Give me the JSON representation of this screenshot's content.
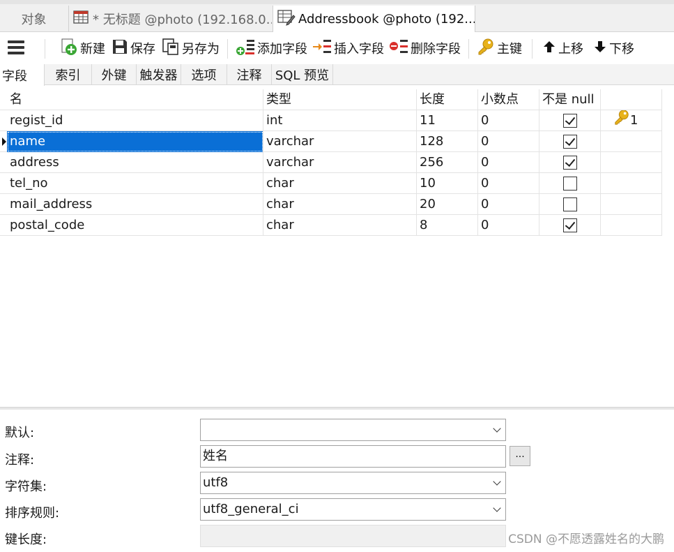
{
  "tabs": [
    {
      "label": "对象"
    },
    {
      "label": "* 无标题 @photo (192.168.0..."
    },
    {
      "label": "Addressbook @photo (192...."
    }
  ],
  "toolbar": {
    "new": "新建",
    "save": "保存",
    "save_as": "另存为",
    "add_field": "添加字段",
    "insert_field": "插入字段",
    "delete_field": "删除字段",
    "primary_key": "主键",
    "move_up": "上移",
    "move_down": "下移"
  },
  "subtabs": [
    "字段",
    "索引",
    "外键",
    "触发器",
    "选项",
    "注释",
    "SQL 预览"
  ],
  "columns": {
    "name": "名",
    "type": "类型",
    "length": "长度",
    "decimals": "小数点",
    "not_null": "不是 null",
    "key": ""
  },
  "fields": [
    {
      "name": "regist_id",
      "type": "int",
      "length": "11",
      "decimals": "0",
      "not_null": true,
      "key": "1"
    },
    {
      "name": "name",
      "type": "varchar",
      "length": "128",
      "decimals": "0",
      "not_null": true,
      "key": ""
    },
    {
      "name": "address",
      "type": "varchar",
      "length": "256",
      "decimals": "0",
      "not_null": true,
      "key": ""
    },
    {
      "name": "tel_no",
      "type": "char",
      "length": "10",
      "decimals": "0",
      "not_null": false,
      "key": ""
    },
    {
      "name": "mail_address",
      "type": "char",
      "length": "20",
      "decimals": "0",
      "not_null": false,
      "key": ""
    },
    {
      "name": "postal_code",
      "type": "char",
      "length": "8",
      "decimals": "0",
      "not_null": true,
      "key": ""
    }
  ],
  "selected_row": 1,
  "properties": {
    "default": {
      "label": "默认:",
      "value": ""
    },
    "comment": {
      "label": "注释:",
      "value": "姓名"
    },
    "charset": {
      "label": "字符集:",
      "value": "utf8"
    },
    "collation": {
      "label": "排序规则:",
      "value": "utf8_general_ci"
    },
    "key_length": {
      "label": "键长度:",
      "value": ""
    }
  },
  "ellipsis_button": "...",
  "watermark": "CSDN @不愿透露姓名的大鹏",
  "colors": {
    "selection": "#0a6fd6",
    "key_gold": "#e8b21a",
    "add_green": "#3aa635",
    "delete_red": "#d9302c"
  }
}
